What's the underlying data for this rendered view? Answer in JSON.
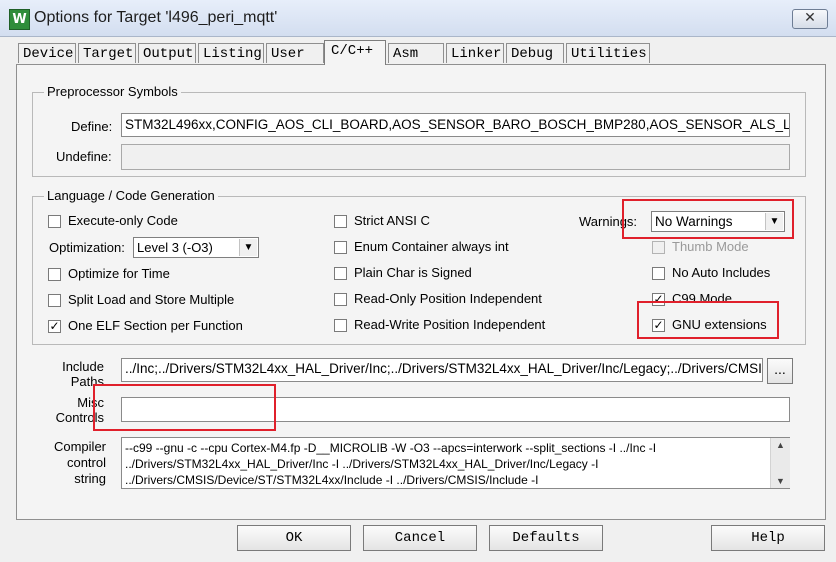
{
  "window": {
    "title": "Options for Target 'l496_peri_mqtt'",
    "app_icon": "W",
    "close_symbol": "✕"
  },
  "tabs": [
    {
      "label": "Device"
    },
    {
      "label": "Target"
    },
    {
      "label": "Output"
    },
    {
      "label": "Listing"
    },
    {
      "label": "User"
    },
    {
      "label": "C/C++",
      "active": true
    },
    {
      "label": "Asm"
    },
    {
      "label": "Linker"
    },
    {
      "label": "Debug"
    },
    {
      "label": "Utilities"
    }
  ],
  "preprocessor": {
    "title": "Preprocessor Symbols",
    "define_label": "Define:",
    "define_value": "STM32L496xx,CONFIG_AOS_CLI_BOARD,AOS_SENSOR_BARO_BOSCH_BMP280,AOS_SENSOR_ALS_LITE",
    "undefine_label": "Undefine:",
    "undefine_value": ""
  },
  "language": {
    "title": "Language / Code Generation",
    "execute_only": {
      "label": "Execute-only Code",
      "checked": false
    },
    "optimization_label": "Optimization:",
    "optimization_value": "Level 3 (-O3)",
    "optimize_time": {
      "label": "Optimize for Time",
      "checked": false
    },
    "split_load": {
      "label": "Split Load and Store Multiple",
      "checked": false
    },
    "one_elf": {
      "label": "One ELF Section per Function",
      "checked": true
    },
    "strict_ansi": {
      "label": "Strict ANSI C",
      "checked": false
    },
    "enum_container": {
      "label": "Enum Container always int",
      "checked": false
    },
    "plain_char": {
      "label": "Plain Char is Signed",
      "checked": false
    },
    "ropi": {
      "label": "Read-Only Position Independent",
      "checked": false
    },
    "rwpi": {
      "label": "Read-Write Position Independent",
      "checked": false
    },
    "warnings_label": "Warnings:",
    "warnings_value": "No Warnings",
    "thumb_mode": {
      "label": "Thumb Mode",
      "checked": false,
      "disabled": true
    },
    "no_auto_includes": {
      "label": "No Auto Includes",
      "checked": false
    },
    "c99_mode": {
      "label": "C99 Mode",
      "checked": true
    },
    "gnu_ext": {
      "label": "GNU extensions",
      "checked": true
    }
  },
  "include_paths": {
    "label": "Include\nPaths",
    "value": "../Inc;../Drivers/STM32L4xx_HAL_Driver/Inc;../Drivers/STM32L4xx_HAL_Driver/Inc/Legacy;../Drivers/CMSIS/D",
    "browse_label": "..."
  },
  "misc_controls": {
    "label": "Misc\nControls",
    "value": ""
  },
  "compiler_string": {
    "label": "Compiler\ncontrol\nstring",
    "lines": [
      "--c99 --gnu -c --cpu Cortex-M4.fp -D__MICROLIB -W -O3 --apcs=interwork --split_sections -I ../Inc -I",
      "../Drivers/STM32L4xx_HAL_Driver/Inc -I ../Drivers/STM32L4xx_HAL_Driver/Inc/Legacy -I",
      "../Drivers/CMSIS/Device/ST/STM32L4xx/Include -I ../Drivers/CMSIS/Include -I"
    ]
  },
  "buttons": {
    "ok": "OK",
    "cancel": "Cancel",
    "defaults": "Defaults",
    "help": "Help"
  },
  "highlight_color": "#e0202b"
}
